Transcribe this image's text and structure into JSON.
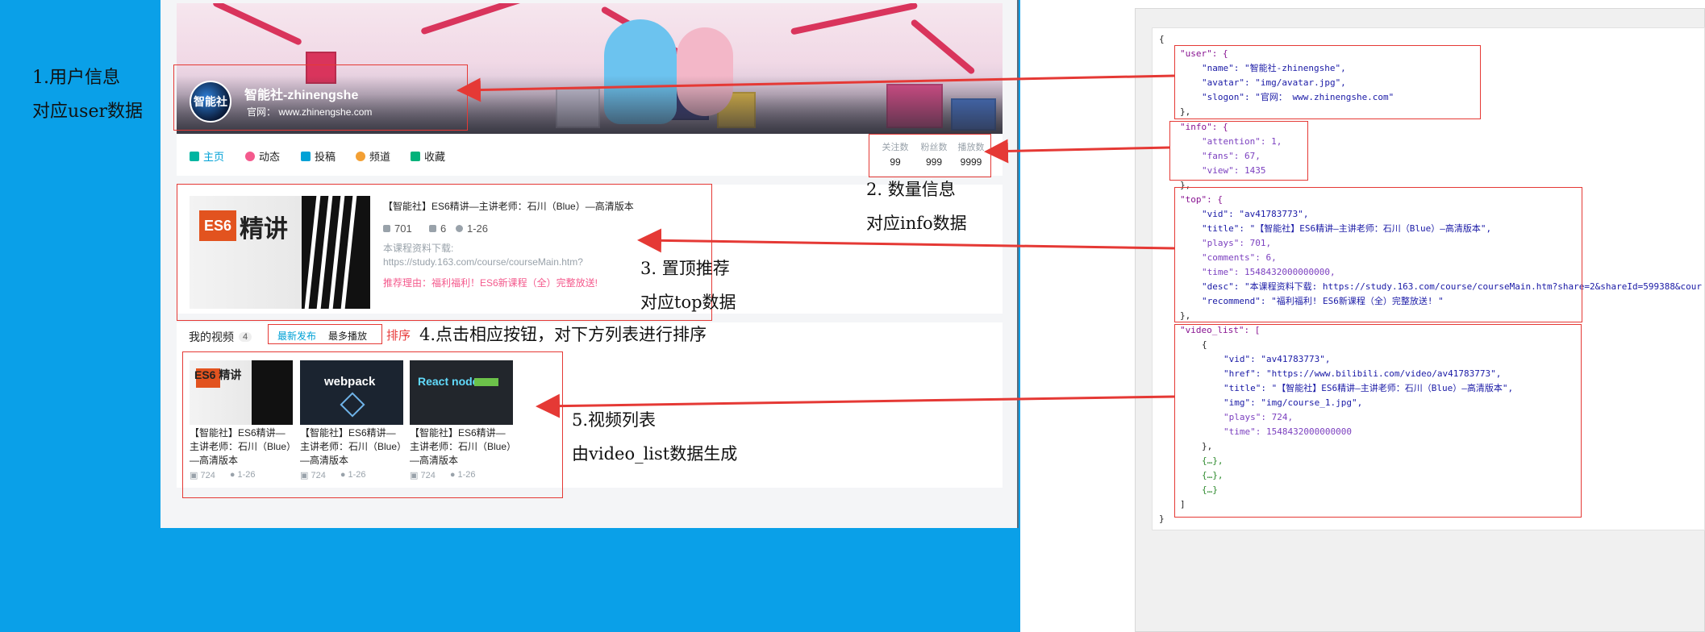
{
  "annotations": {
    "a1_line1": "1.用户信息",
    "a1_line2": "对应user数据",
    "a2_line1": "2. 数量信息",
    "a2_line2": "对应info数据",
    "a3_line1": "3. 置顶推荐",
    "a3_line2": "对应top数据",
    "a4": "4.点击相应按钮，对下方列表进行排序",
    "a5_line1": "5.视频列表",
    "a5_line2": "由video_list数据生成"
  },
  "user": {
    "name": "智能社-zhinengshe",
    "avatar_text": "智能社",
    "slogon": "官网： www.zhinengshe.com"
  },
  "nav": {
    "items": [
      "主页",
      "动态",
      "投稿",
      "频道",
      "收藏"
    ],
    "colors": [
      "#00b5a1",
      "#f45a8d",
      "#00a1d6",
      "#f3a034",
      "#00b27a"
    ]
  },
  "info": {
    "labels": [
      "关注数",
      "粉丝数",
      "播放数"
    ],
    "values": [
      "99",
      "999",
      "9999"
    ]
  },
  "top": {
    "cover_tag": "ES6",
    "cover_big": "精讲",
    "title": "【智能社】ES6精讲—主讲老师：石川（Blue）—高清版本",
    "plays": "701",
    "comments": "6",
    "time": "1-26",
    "desc_1": "本课程资料下载:",
    "desc_2": "https://study.163.com/course/courseMain.htm?",
    "recommend": "推荐理由：福利福利！ES6新课程（全）完整放送!"
  },
  "videos": {
    "label": "我的视频",
    "count": "4",
    "sort_latest": "最新发布",
    "sort_plays": "最多播放",
    "sort_label": "排序",
    "list": [
      {
        "thumb": "ES6 精讲",
        "title": "【智能社】ES6精讲—主讲老师：石川（Blue）—高清版本",
        "plays": "724",
        "time": "1-26"
      },
      {
        "thumb": "webpack",
        "title": "【智能社】ES6精讲—主讲老师：石川（Blue）—高清版本",
        "plays": "724",
        "time": "1-26"
      },
      {
        "thumb": "React node",
        "title": "【智能社】ES6精讲—主讲老师：石川（Blue）—高清版本",
        "plays": "724",
        "time": "1-26"
      }
    ]
  },
  "json_view": {
    "l01": "{",
    "l02": "\"user\": {",
    "l03": "\"name\": \"智能社-zhinengshe\",",
    "l04": "\"avatar\": \"img/avatar.jpg\",",
    "l05": "\"slogon\": \"官网： www.zhinengshe.com\"",
    "l06": "},",
    "l07": "\"info\": {",
    "l08": "\"attention\": 1,",
    "l09": "\"fans\": 67,",
    "l10": "\"view\": 1435",
    "l11": "},",
    "l12": "\"top\": {",
    "l13": "\"vid\": \"av41783773\",",
    "l14": "\"title\": \"【智能社】ES6精讲—主讲老师：石川（Blue）—高清版本\",",
    "l15": "\"plays\": 701,",
    "l16": "\"comments\": 6,",
    "l17": "\"time\": 1548432000000000,",
    "l18": "\"desc\": \"本课程资料下载: https://study.163.com/course/courseMain.htm?share=2&shareId=599388&cour",
    "l19": "\"recommend\": \"福利福利! ES6新课程（全）完整放送! \"",
    "l20": "},",
    "l21": "\"video_list\": [",
    "l22": "{",
    "l23": "\"vid\": \"av41783773\",",
    "l24": "\"href\": \"https://www.bilibili.com/video/av41783773\",",
    "l25": "\"title\": \"【智能社】ES6精讲—主讲老师：石川（Blue）—高清版本\",",
    "l26": "\"img\": \"img/course_1.jpg\",",
    "l27": "\"plays\": 724,",
    "l28": "\"time\": 1548432000000000",
    "l29": "},",
    "l30": "{…},",
    "l31": "{…},",
    "l32": "{…}",
    "l33": "]",
    "l34": "}"
  }
}
